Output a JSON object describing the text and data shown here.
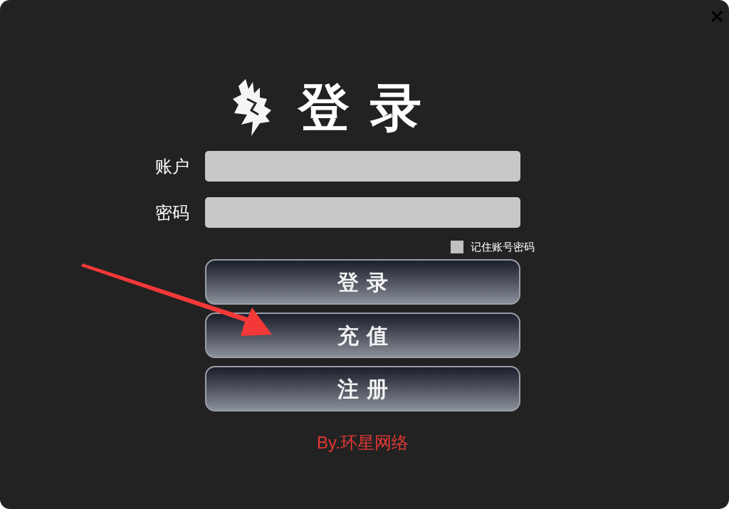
{
  "title": "登录",
  "fields": [
    {
      "label": "账户"
    },
    {
      "label": "密码"
    }
  ],
  "remember": {
    "label": "记住账号密码",
    "checked": false
  },
  "buttons": [
    "登录",
    "充值",
    "注册"
  ],
  "footer": "By.环星网络"
}
